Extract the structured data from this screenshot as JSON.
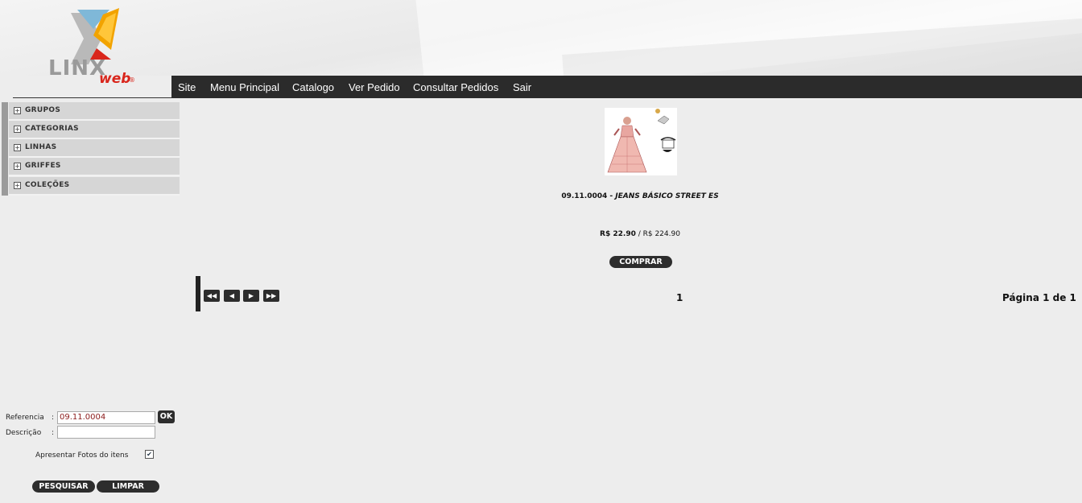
{
  "brand": {
    "logo_main": "LINX",
    "logo_sub": "web",
    "logo_mark": "®"
  },
  "nav": [
    {
      "label": "Site"
    },
    {
      "label": "Menu Principal"
    },
    {
      "label": "Catalogo"
    },
    {
      "label": "Ver Pedido"
    },
    {
      "label": "Consultar Pedidos"
    },
    {
      "label": "Sair"
    }
  ],
  "sidebar": {
    "items": [
      {
        "label": "GRUPOS"
      },
      {
        "label": "CATEGORIAS"
      },
      {
        "label": "LINHAS"
      },
      {
        "label": "GRIFFES"
      },
      {
        "label": "COLEÇÕES"
      }
    ],
    "expand_icon": "plus-box-icon"
  },
  "product": {
    "code": "09.11.0004",
    "separator": " - ",
    "name": "JEANS BÁSICO STREET ES",
    "price": "R$ 22.90",
    "price_separator": " / ",
    "price_alt": "R$ 224.90",
    "buy_label": "COMPRAR"
  },
  "pager": {
    "current": "1",
    "summary": "Página 1 de 1",
    "icons": [
      "first-page-icon",
      "prev-page-icon",
      "next-page-icon",
      "last-page-icon"
    ]
  },
  "search": {
    "ref_label": "Referencia",
    "ref_value": "09.11.0004",
    "ok_label": "OK",
    "desc_label": "Descrição",
    "desc_value": "",
    "photos_label": "Apresentar Fotos do itens",
    "photos_checked": true,
    "search_label": "PESQUISAR",
    "clear_label": "LIMPAR"
  }
}
